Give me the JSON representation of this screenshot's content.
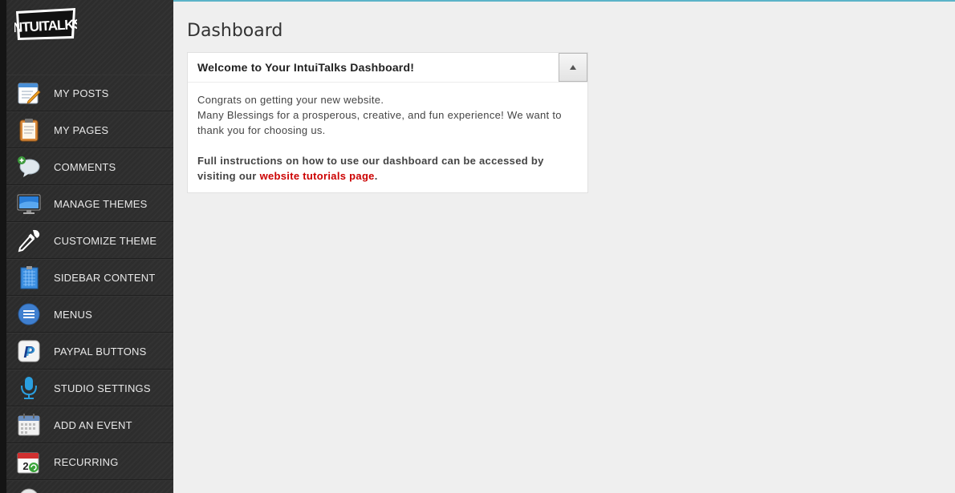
{
  "logo_text": "INTUITALKS",
  "sidebar": {
    "items": [
      {
        "label": "MY POSTS",
        "icon": "pencil-note-icon"
      },
      {
        "label": "MY PAGES",
        "icon": "clipboard-icon"
      },
      {
        "label": "COMMENTS",
        "icon": "speech-bubble-icon"
      },
      {
        "label": "MANAGE THEMES",
        "icon": "monitor-icon"
      },
      {
        "label": "CUSTOMIZE THEME",
        "icon": "eyedropper-icon"
      },
      {
        "label": "SIDEBAR CONTENT",
        "icon": "sidebar-grid-icon"
      },
      {
        "label": "MENUS",
        "icon": "menu-list-icon"
      },
      {
        "label": "PAYPAL BUTTONS",
        "icon": "paypal-icon"
      },
      {
        "label": "STUDIO SETTINGS",
        "icon": "microphone-icon"
      },
      {
        "label": "ADD AN EVENT",
        "icon": "calendar-icon"
      },
      {
        "label": "RECURRING",
        "icon": "recurring-calendar-icon"
      }
    ]
  },
  "main": {
    "title": "Dashboard",
    "widget": {
      "title": "Welcome to Your IntuiTalks Dashboard!",
      "line1": "Congrats on getting your new website.",
      "line2": "Many Blessings for a prosperous, creative, and fun experience! We want to thank you for choosing us.",
      "instructions_prefix": "Full instructions on how to use our dashboard can be accessed by visiting our ",
      "link_text": "website tutorials page",
      "instructions_suffix": "."
    }
  },
  "colors": {
    "accent_link": "#cc0000",
    "top_line": "#5bb3c8",
    "sidebar_bg": "#2a2a2a"
  }
}
